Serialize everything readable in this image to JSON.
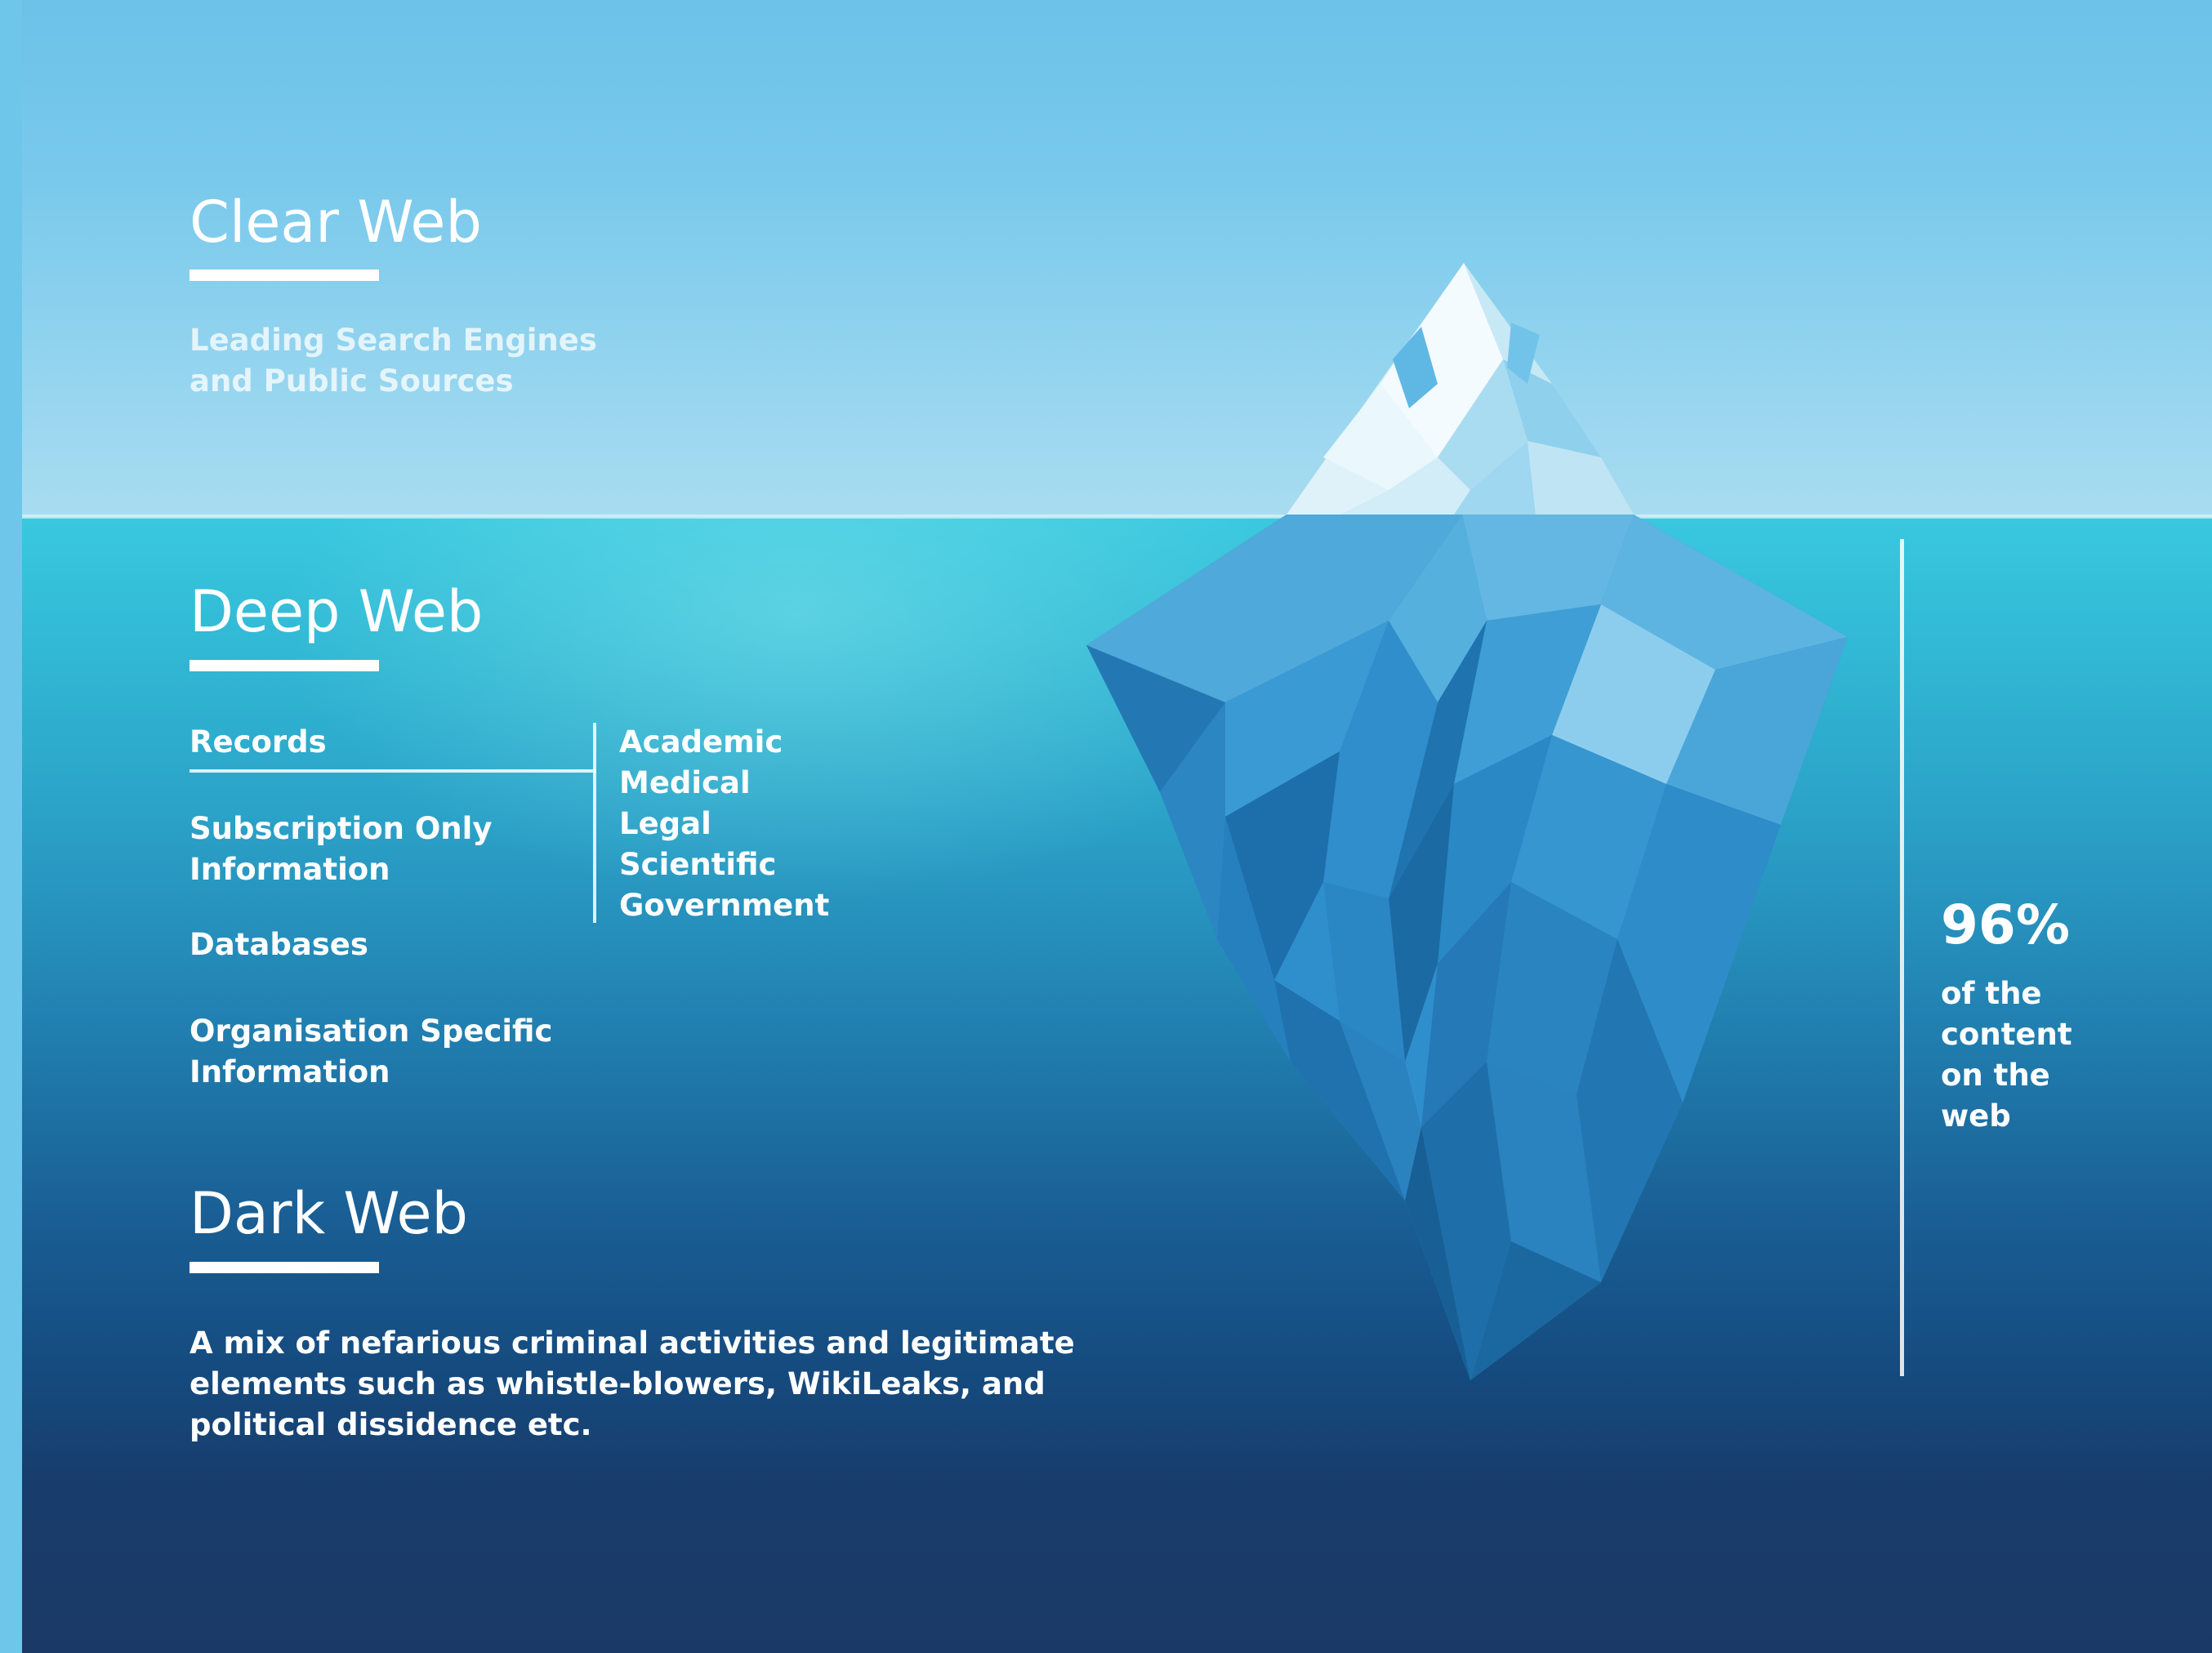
{
  "clear_web": {
    "title": "Clear Web",
    "description_line1": "Leading Search Engines",
    "description_line2": "and Public Sources"
  },
  "deep_web": {
    "title": "Deep Web",
    "items": {
      "records": "Records",
      "subscription_line1": "Subscription Only",
      "subscription_line2": "Information",
      "databases": "Databases",
      "organisation_line1": "Organisation Specific",
      "organisation_line2": "Information"
    },
    "record_types": [
      "Academic",
      "Medical",
      "Legal",
      "Scientific",
      "Government"
    ]
  },
  "dark_web": {
    "title": "Dark Web",
    "description_line1": "A mix of nefarious criminal activities and legitimate",
    "description_line2": "elements such as whistle-blowers, WikiLeaks, and",
    "description_line3": "political dissidence etc."
  },
  "statistic": {
    "value": "96%",
    "caption_line1": "of the",
    "caption_line2": "content",
    "caption_line3": "on the",
    "caption_line4": "web"
  },
  "colors": {
    "sky": "#79c9ec",
    "surface_water": "#39c8df",
    "deep_water": "#1b3966",
    "iceberg_light": "#e8f6fb",
    "iceberg_blue": "#2f8fcc",
    "text": "#ffffff"
  }
}
